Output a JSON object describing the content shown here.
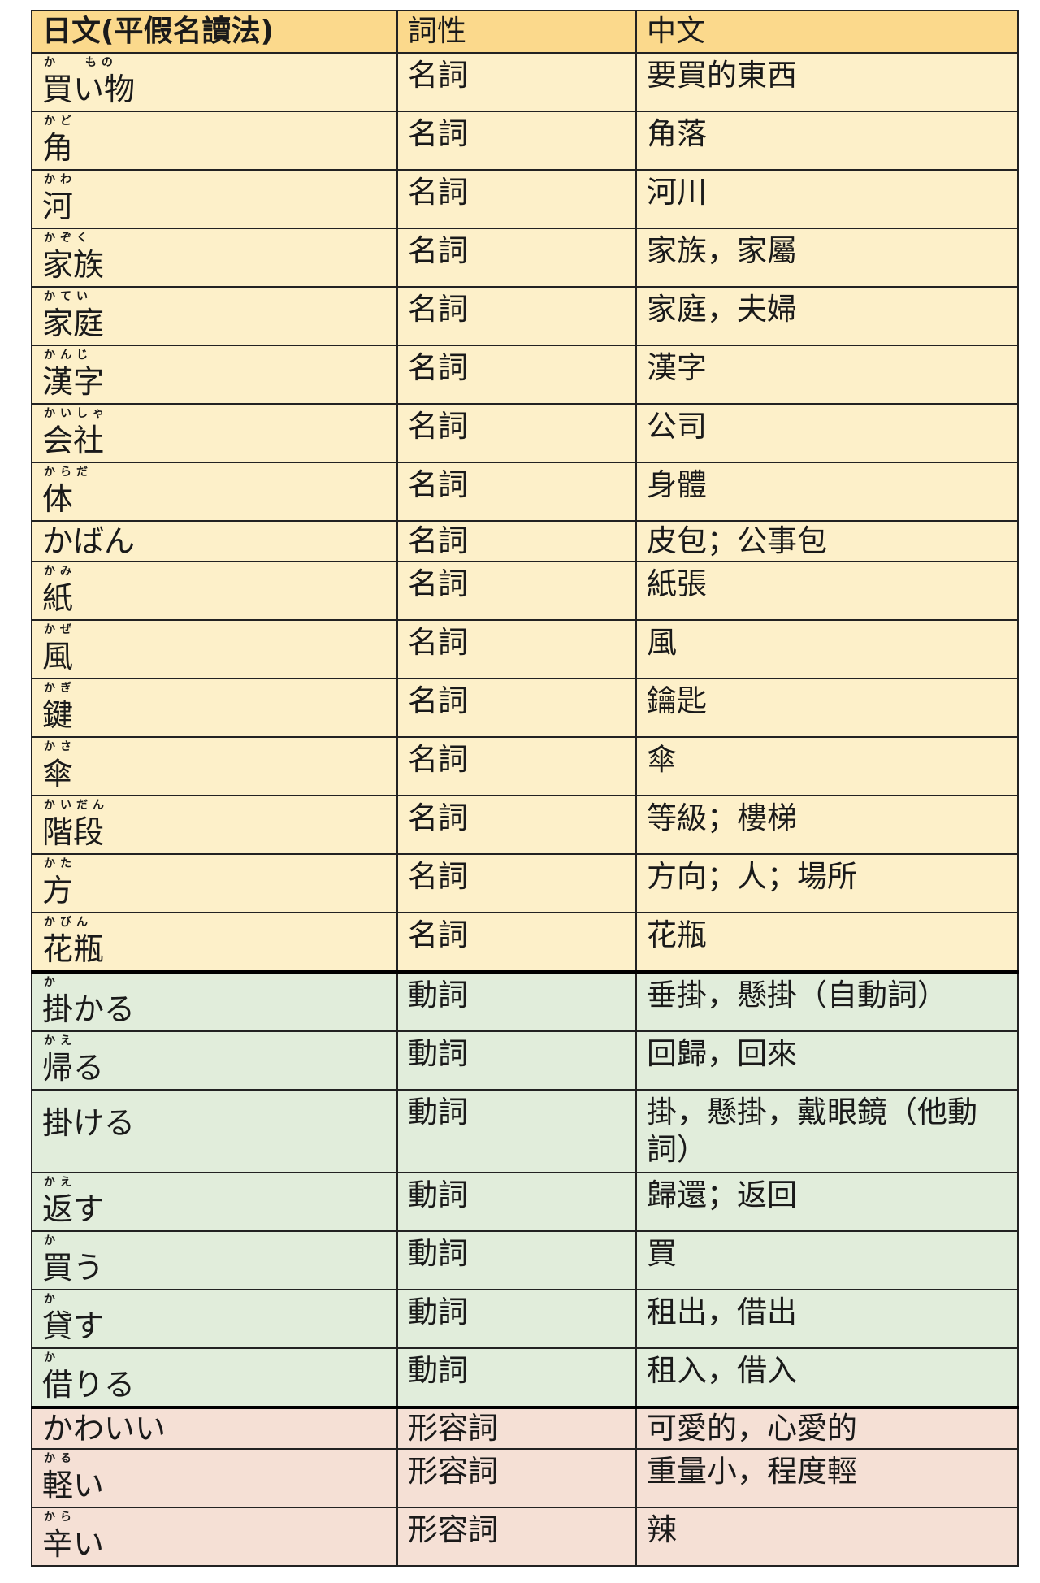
{
  "header": {
    "col_japanese": "日文(平假名讀法)",
    "col_pos": "詞性",
    "col_chinese": "中文"
  },
  "colors": {
    "header": "#fbd98c",
    "noun": "#fdf0c9",
    "verb": "#e1eddb",
    "adjective": "#f5e0d5"
  },
  "rows": [
    {
      "furigana": "か　 もの",
      "word": "買い物",
      "pos": "名詞",
      "meaning": "要買的東西"
    },
    {
      "furigana": "かど",
      "word": "角",
      "pos": "名詞",
      "meaning": "角落"
    },
    {
      "furigana": "かわ",
      "word": "河",
      "pos": "名詞",
      "meaning": "河川"
    },
    {
      "furigana": "かぞく",
      "word": "家族",
      "pos": "名詞",
      "meaning": "家族，家屬"
    },
    {
      "furigana": "かてい",
      "word": "家庭",
      "pos": "名詞",
      "meaning": "家庭，夫婦"
    },
    {
      "furigana": "かんじ",
      "word": "漢字",
      "pos": "名詞",
      "meaning": "漢字"
    },
    {
      "furigana": "かいしゃ",
      "word": "会社",
      "pos": "名詞",
      "meaning": "公司"
    },
    {
      "furigana": "からだ",
      "word": "体",
      "pos": "名詞",
      "meaning": "身體"
    },
    {
      "furigana": "",
      "word": "かばん",
      "pos": "名詞",
      "meaning": "皮包；公事包"
    },
    {
      "furigana": "かみ",
      "word": "紙",
      "pos": "名詞",
      "meaning": "紙張"
    },
    {
      "furigana": "かぜ",
      "word": "風",
      "pos": "名詞",
      "meaning": "風"
    },
    {
      "furigana": "かぎ",
      "word": "鍵",
      "pos": "名詞",
      "meaning": "鑰匙"
    },
    {
      "furigana": "かさ",
      "word": "傘",
      "pos": "名詞",
      "meaning": "傘"
    },
    {
      "furigana": "かいだん",
      "word": "階段",
      "pos": "名詞",
      "meaning": "等級；樓梯"
    },
    {
      "furigana": "かた",
      "word": "方",
      "pos": "名詞",
      "meaning": "方向；人；場所"
    },
    {
      "furigana": "かびん",
      "word": "花瓶",
      "pos": "名詞",
      "meaning": "花瓶"
    },
    {
      "furigana": "か",
      "word": "掛かる",
      "pos": "動詞",
      "meaning": "垂掛，懸掛（自動詞）"
    },
    {
      "furigana": "かえ",
      "word": "帰る",
      "pos": "動詞",
      "meaning": "回歸，回來"
    },
    {
      "furigana": "",
      "word": "掛ける",
      "pos": "動詞",
      "meaning": "掛，懸掛，戴眼鏡（他動詞）"
    },
    {
      "furigana": "かえ",
      "word": "返す",
      "pos": "動詞",
      "meaning": "歸還；返回"
    },
    {
      "furigana": "か",
      "word": "買う",
      "pos": "動詞",
      "meaning": "買"
    },
    {
      "furigana": "か",
      "word": "貸す",
      "pos": "動詞",
      "meaning": "租出，借出"
    },
    {
      "furigana": "か",
      "word": "借りる",
      "pos": "動詞",
      "meaning": "租入，借入"
    },
    {
      "furigana": "",
      "word": "かわいい",
      "pos": "形容詞",
      "meaning": "可愛的，心愛的"
    },
    {
      "furigana": "かる",
      "word": "軽い",
      "pos": "形容詞",
      "meaning": "重量小，程度輕"
    },
    {
      "furigana": "から",
      "word": "辛い",
      "pos": "形容詞",
      "meaning": "辣"
    }
  ]
}
